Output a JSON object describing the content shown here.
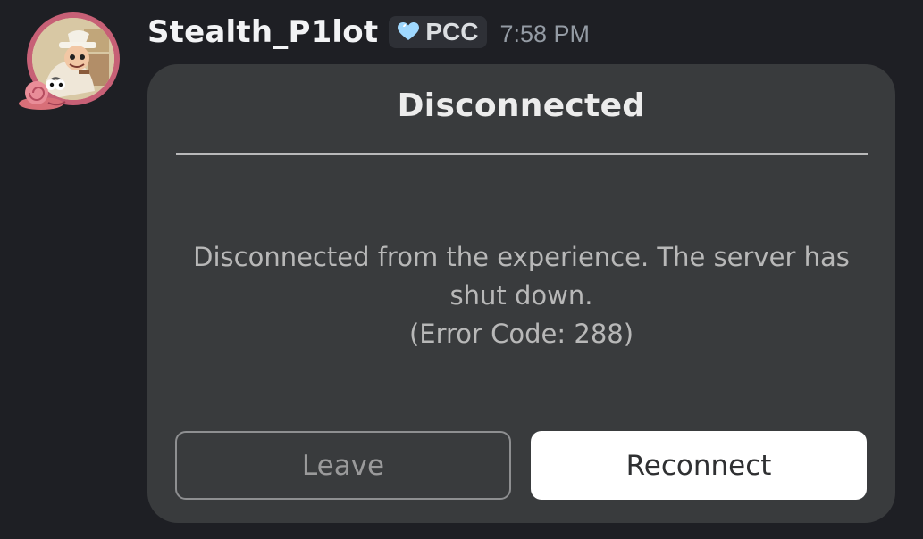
{
  "message": {
    "username": "Stealth_P1lot",
    "tag": {
      "label": "PCC",
      "icon": "heart-shield-icon"
    },
    "timestamp": "7:58 PM",
    "avatar": {
      "icon": "avatar-image",
      "accent": "#c76076"
    }
  },
  "dialog": {
    "title": "Disconnected",
    "message": "Disconnected from the experience. The server has shut down.",
    "error": "(Error Code: 288)",
    "buttons": {
      "leave": "Leave",
      "reconnect": "Reconnect"
    }
  },
  "colors": {
    "background": "#1e1f24",
    "dialog": "#393b3d",
    "primary_button": "#ffffff"
  }
}
